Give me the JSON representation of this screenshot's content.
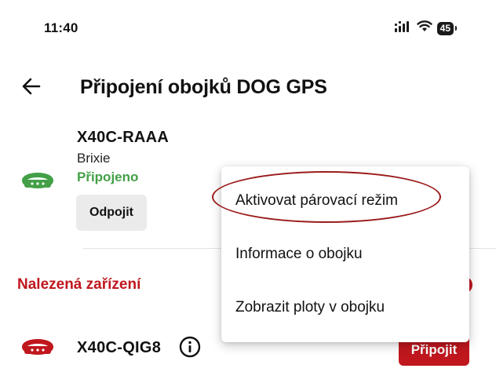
{
  "status_bar": {
    "time": "11:40",
    "battery": "45",
    "icons": [
      "signal-icon",
      "wifi-icon",
      "battery-icon"
    ]
  },
  "header": {
    "back_icon": "arrow-left-icon",
    "title": "Připojení obojků DOG GPS"
  },
  "connected_device": {
    "name": "X40C-RAAA",
    "owner": "Brixie",
    "status": "Připojeno",
    "icon": "collar-icon",
    "icon_color": "#43a047",
    "disconnect_label": "Odpojit"
  },
  "found_section": {
    "title": "Nalezená zařízení",
    "title_color": "#c0171e"
  },
  "found_devices": [
    {
      "name": "X40C-QIG8",
      "icon": "collar-icon",
      "icon_color": "#c0171e",
      "info_icon": "info-icon",
      "connect_label": "Připojit"
    }
  ],
  "popup_menu": {
    "items": [
      {
        "label": "Aktivovat párovací režim",
        "highlighted": true
      },
      {
        "label": "Informace o obojku"
      },
      {
        "label": "Zobrazit ploty v obojku"
      }
    ],
    "highlight_color": "#9b1b1b"
  },
  "colors": {
    "accent_red": "#c0171e",
    "status_green": "#43a047",
    "button_gray": "#ebebeb"
  }
}
